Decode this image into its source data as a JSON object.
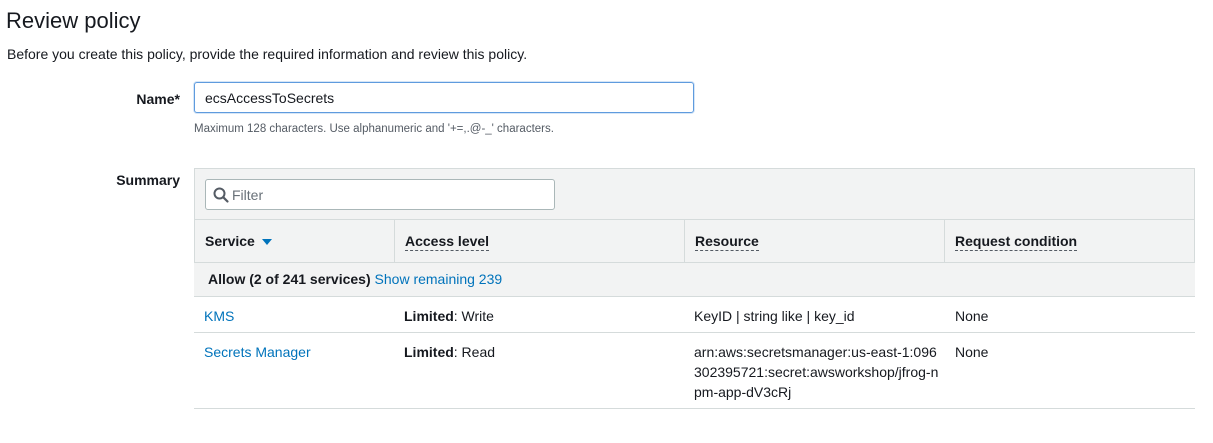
{
  "page": {
    "title": "Review policy",
    "description": "Before you create this policy, provide the required information and review this policy."
  },
  "name_field": {
    "label": "Name*",
    "value": "ecsAccessToSecrets",
    "hint": "Maximum 128 characters. Use alphanumeric and '+=,.@-_' characters."
  },
  "summary": {
    "label": "Summary",
    "filter_placeholder": "Filter",
    "columns": {
      "service": "Service",
      "access_level": "Access level",
      "resource": "Resource",
      "request_condition": "Request condition"
    },
    "allow_group": {
      "label": "Allow (2 of 241 services)",
      "link": "Show remaining 239"
    },
    "rows": [
      {
        "service": "KMS",
        "access_prefix": "Limited",
        "access_value": ": Write",
        "resource": "KeyID | string like | key_id",
        "condition": "None"
      },
      {
        "service": "Secrets Manager",
        "access_prefix": "Limited",
        "access_value": ": Read",
        "resource": "arn:aws:secretsmanager:us-east-1:096302395721:secret:awsworkshop/jfrog-npm-app-dV3cRj",
        "condition": "None"
      }
    ]
  },
  "colors": {
    "link": "#0073bb",
    "header_bg": "#f2f3f3",
    "border": "#d5dbdb",
    "focus": "#5f9bde"
  }
}
